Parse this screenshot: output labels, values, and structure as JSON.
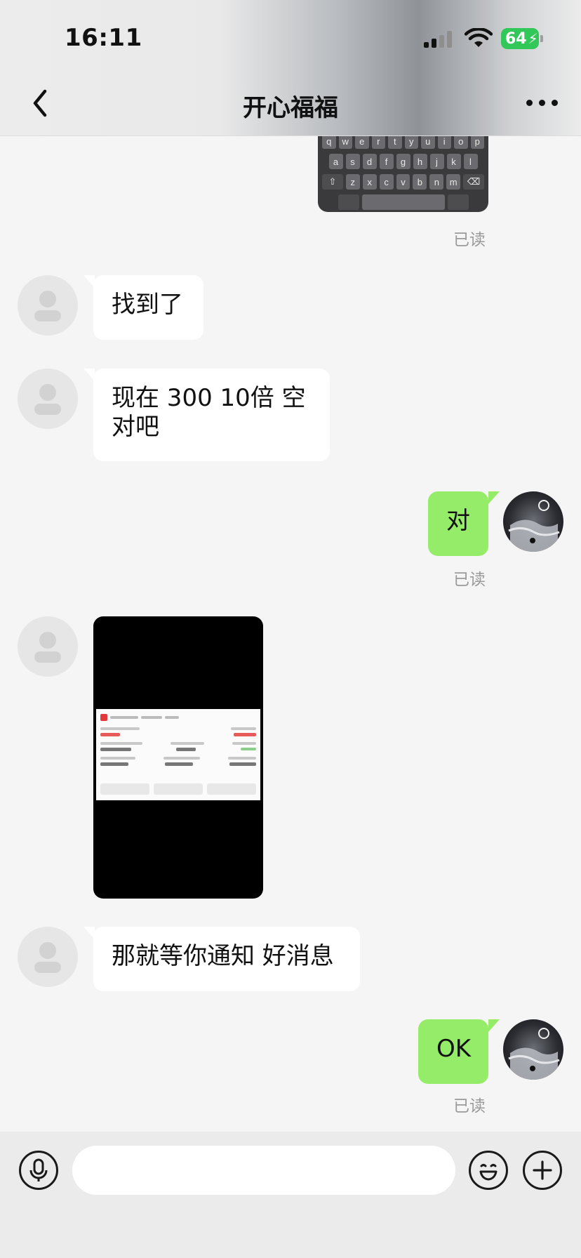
{
  "status_bar": {
    "time": "16:11",
    "battery_percent": "64",
    "battery_charging": true,
    "signal_bars": 4,
    "signal_bars_active": 2,
    "wifi": true
  },
  "header": {
    "title": "开心福福",
    "back_icon": "chevron-left-icon",
    "more_icon": "more-dots-icon"
  },
  "keyboard_preview": {
    "row1": [
      "q",
      "w",
      "e",
      "r",
      "t",
      "y",
      "u",
      "i",
      "o",
      "p"
    ],
    "row2": [
      "a",
      "s",
      "d",
      "f",
      "g",
      "h",
      "j",
      "k",
      "l"
    ],
    "row3": [
      "z",
      "x",
      "c",
      "v",
      "b",
      "n",
      "m"
    ]
  },
  "messages": [
    {
      "from": "self",
      "type": "image",
      "status": "已读"
    },
    {
      "from": "other",
      "type": "text",
      "text": "找到了"
    },
    {
      "from": "other",
      "type": "text",
      "text": "现在 300 10倍 空 对吧"
    },
    {
      "from": "self",
      "type": "text",
      "text": "对",
      "status": "已读"
    },
    {
      "from": "other",
      "type": "image"
    },
    {
      "from": "other",
      "type": "text",
      "text": "那就等你通知 好消息"
    },
    {
      "from": "self",
      "type": "text",
      "text": "OK",
      "status": "已读"
    }
  ],
  "text": {
    "read_1": "已读",
    "msg_found": "找到了",
    "msg_now_line1": "现在 300 10倍 空",
    "msg_now_line2": "对吧",
    "msg_yes": "对",
    "read_2": "已读",
    "msg_wait": "那就等你通知 好消息",
    "msg_ok": "OK",
    "read_3": "已读"
  },
  "input_bar": {
    "voice_icon": "microphone-icon",
    "emoji_icon": "emoji-icon",
    "plus_icon": "plus-icon",
    "input_value": "",
    "input_placeholder": ""
  },
  "colors": {
    "background": "#f5f5f5",
    "bubble_self": "#95ec69",
    "bubble_other": "#ffffff",
    "read_text": "#9a9a9a",
    "battery": "#31c759"
  }
}
